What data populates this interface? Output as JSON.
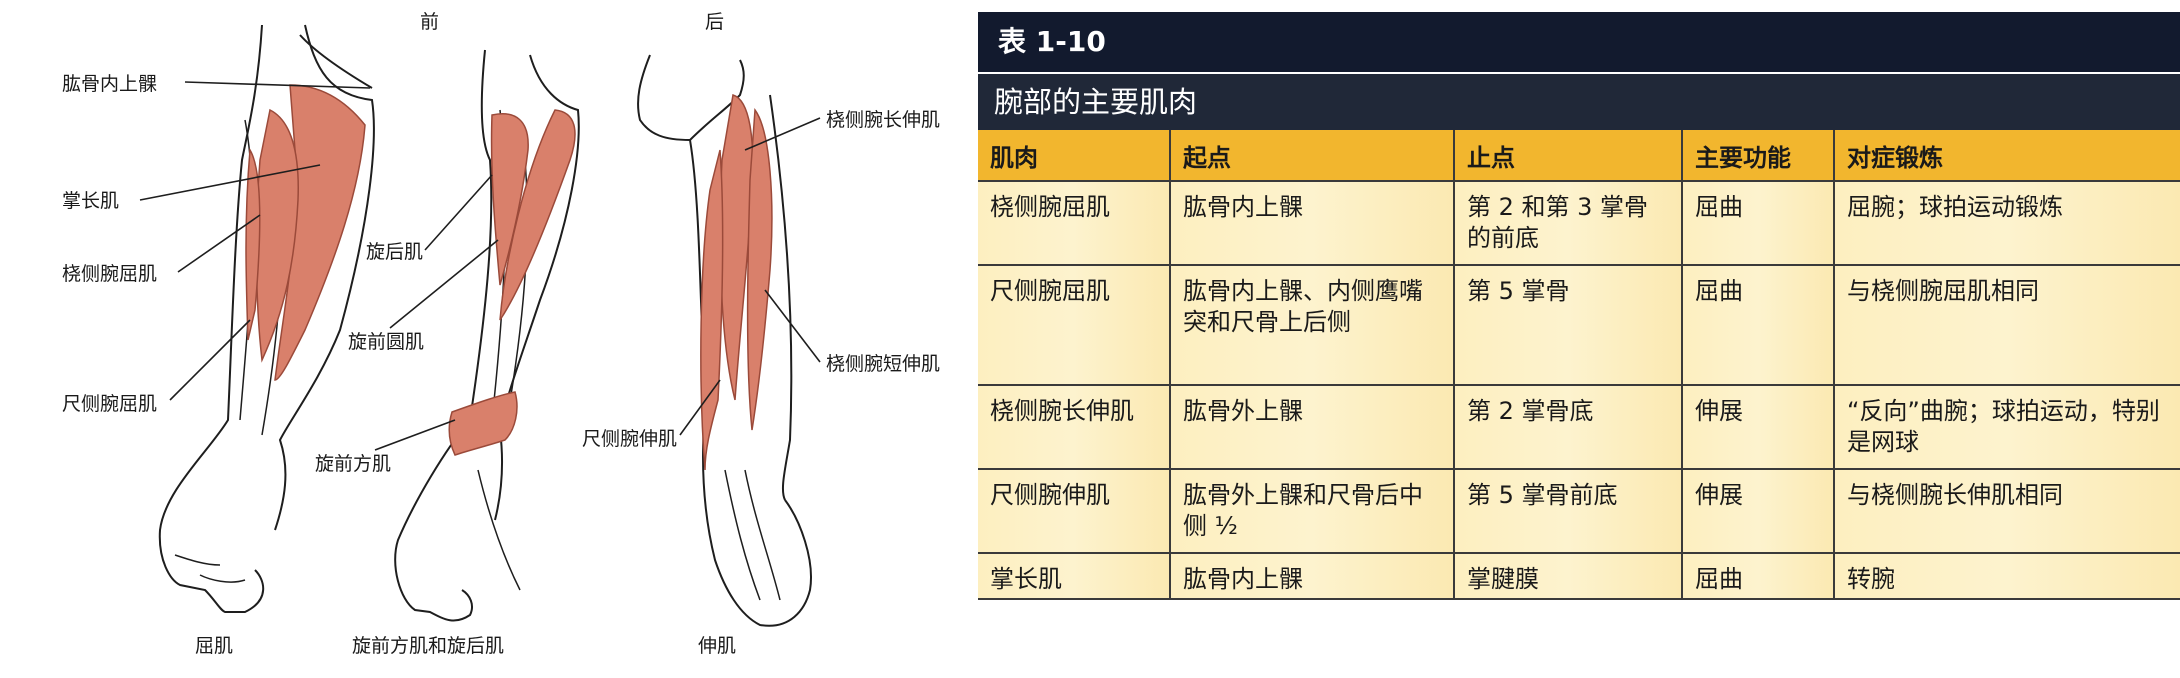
{
  "figure": {
    "view_front": "前",
    "view_back": "后",
    "labels": {
      "medial_epicondyle": "肱骨内上髁",
      "palmaris_longus": "掌长肌",
      "fcr": "桡侧腕屈肌",
      "fcu": "尺侧腕屈肌",
      "supinator": "旋后肌",
      "pronator_teres": "旋前圆肌",
      "pronator_quadratus": "旋前方肌",
      "ecrl": "桡侧腕长伸肌",
      "ecrb": "桡侧腕短伸肌",
      "ecu": "尺侧腕伸肌"
    },
    "captions": {
      "flexors": "屈肌",
      "pronators": "旋前方肌和旋后肌",
      "extensors": "伸肌"
    },
    "colors": {
      "muscle": "#d9806b",
      "bone_stroke": "#1e1e1e"
    }
  },
  "table": {
    "number": "表 1-10",
    "title": "腕部的主要肌肉",
    "headers": [
      "肌肉",
      "起点",
      "止点",
      "主要功能",
      "对症锻炼"
    ],
    "rows": [
      [
        "桡侧腕屈肌",
        "肱骨内上髁",
        "第 2 和第 3 掌骨的前底",
        "屈曲",
        "屈腕；球拍运动锻炼"
      ],
      [
        "尺侧腕屈肌",
        "肱骨内上髁、内侧鹰嘴突和尺骨上后侧",
        "第 5 掌骨",
        "屈曲",
        "与桡侧腕屈肌相同"
      ],
      [
        "桡侧腕长伸肌",
        "肱骨外上髁",
        "第 2 掌骨底",
        "伸展",
        "“反向”曲腕；球拍运动，特别是网球"
      ],
      [
        "尺侧腕伸肌",
        "肱骨外上髁和尺骨后中侧 ½",
        "第 5 掌骨前底",
        "伸展",
        "与桡侧腕长伸肌相同"
      ],
      [
        "掌长肌",
        "肱骨内上髁",
        "掌腱膜",
        "屈曲",
        "转腕"
      ]
    ],
    "colors": {
      "header_dark": "#121a2e",
      "title_bar": "#202838",
      "column_header": "#f2b62e",
      "cell_bg": "#fdf0c4"
    }
  }
}
